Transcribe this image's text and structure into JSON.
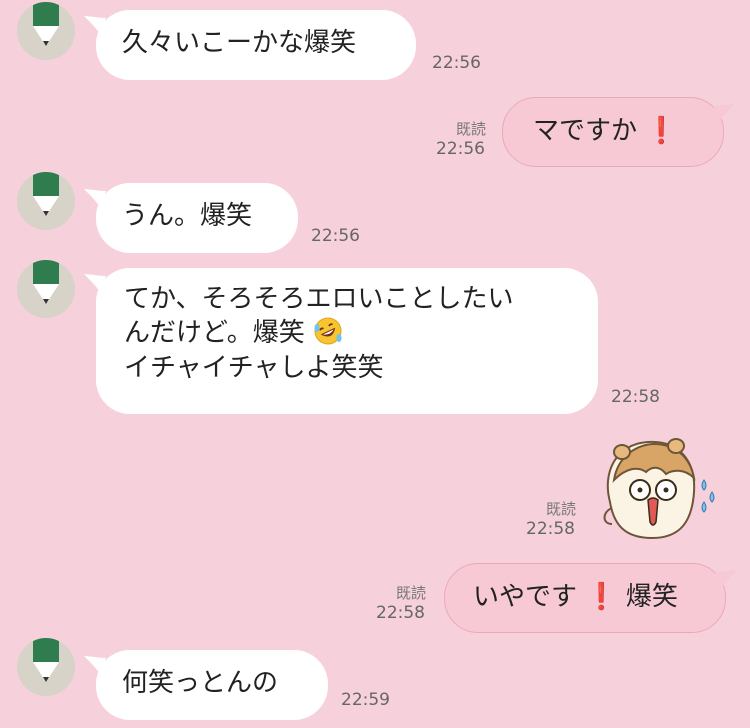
{
  "messages": [
    {
      "id": "m1",
      "sender": "them",
      "text": "久々いこーかな爆笑",
      "time": "22:56"
    },
    {
      "id": "m2",
      "sender": "me",
      "text": "マですか",
      "exclaim": "❗",
      "time": "22:56",
      "read_label": "既読"
    },
    {
      "id": "m3",
      "sender": "them",
      "text": "うん。爆笑",
      "time": "22:56"
    },
    {
      "id": "m4",
      "sender": "them",
      "lines": [
        "てか、そろそろエロいことしたい",
        "んだけど。爆笑",
        "イチャイチャしよ笑笑"
      ],
      "emoji": "rolling-on-floor-laughing",
      "time": "22:58"
    },
    {
      "id": "m5",
      "sender": "me",
      "type": "sticker",
      "sticker": "hamster-sweating",
      "time": "22:58",
      "read_label": "既読"
    },
    {
      "id": "m6",
      "sender": "me",
      "text_before": "いやです",
      "exclaim": "❗",
      "text_after": "爆笑",
      "time": "22:58",
      "read_label": "既読"
    },
    {
      "id": "m7",
      "sender": "them",
      "text": "何笑っとんの",
      "time": "22:59"
    }
  ],
  "colors": {
    "background": "#f6d1dc",
    "incoming_bubble": "#ffffff",
    "outgoing_bubble": "#f7c9d5",
    "exclaim": "#d9202a",
    "avatar_green": "#2f7d4f"
  }
}
